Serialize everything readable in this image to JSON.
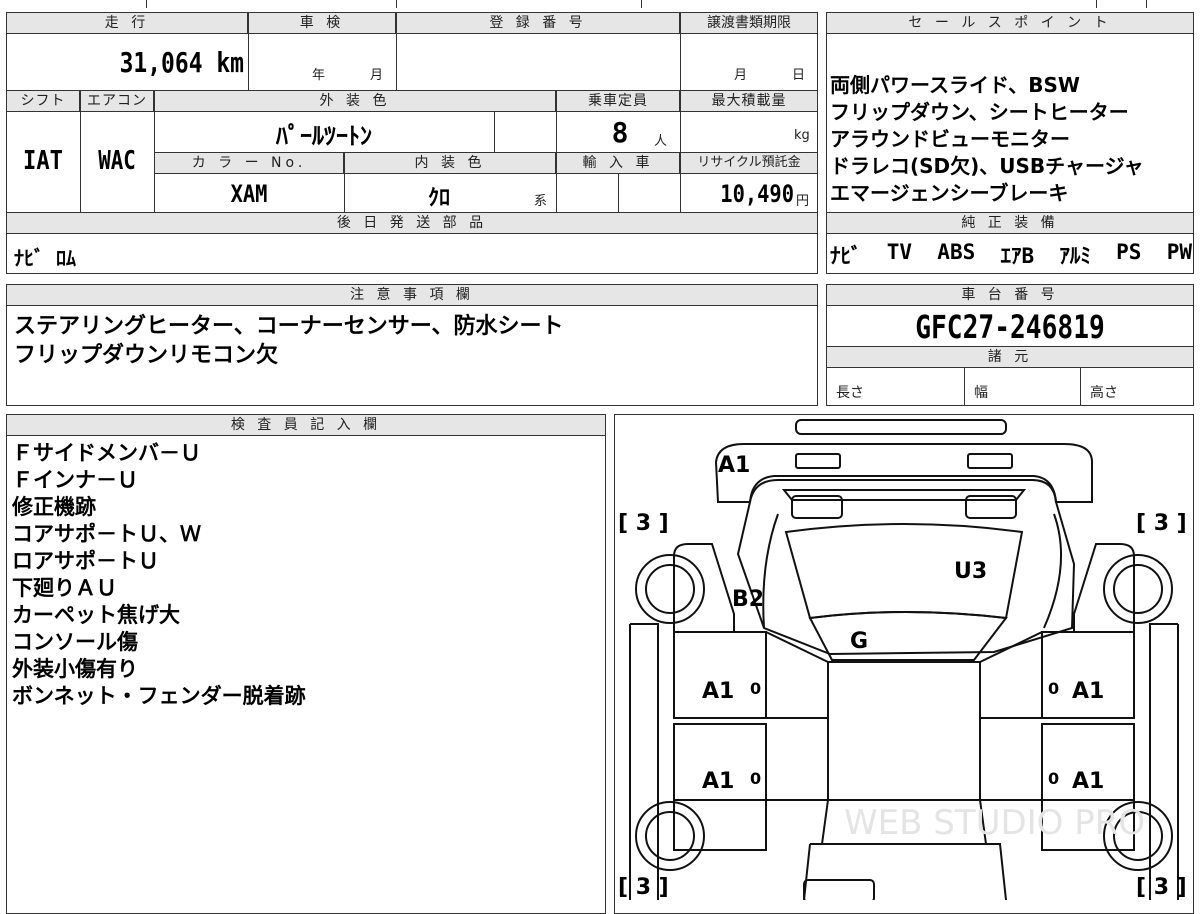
{
  "sheet": {
    "mileage": {
      "label": "走 行",
      "value": "31,064 km"
    },
    "shaken": {
      "label": "車 検",
      "year_unit": "年",
      "month_unit": "月"
    },
    "registration": {
      "label": "登 録 番 号"
    },
    "transfer": {
      "label": "譲渡書類期限",
      "month_unit": "月",
      "day_unit": "日"
    },
    "shift": {
      "label": "シフト",
      "value": "IAT"
    },
    "aircon": {
      "label": "エアコン",
      "value": "WAC"
    },
    "exterior_color": {
      "label": "外 装 色",
      "value": "ﾊﾟｰﾙﾂｰﾄﾝ"
    },
    "capacity": {
      "label": "乗車定員",
      "value": "8",
      "unit": "人"
    },
    "max_load": {
      "label": "最大積載量",
      "unit": "kg"
    },
    "color_no": {
      "label": "カ ラ ー No.",
      "value": "XAM"
    },
    "interior_color": {
      "label": "内 装 色",
      "value": "ｸﾛ",
      "unit": "系"
    },
    "import": {
      "label": "輸 入 車"
    },
    "recycle": {
      "label": "リサイクル預託金",
      "value": "10,490",
      "unit": "円"
    },
    "parts": {
      "label": "後 日 発 送 部 品",
      "value": "ﾅﾋﾞ ﾛﾑ"
    },
    "sales_points": {
      "label": "セ ー ル ス ポ イ ン ト",
      "lines": [
        "両側パワースライド、BSW",
        "フリップダウン、シートヒーター",
        "アラウンドビューモニター",
        "ドラレコ(SD欠)、USBチャージャ",
        "エマージェンシーブレーキ"
      ]
    },
    "standard_equipment": {
      "label": "純 正 装 備",
      "items": [
        "ﾅﾋﾞ",
        "TV",
        "ABS",
        "ｴｱB",
        "ｱﾙﾐ",
        "PS",
        "PW"
      ]
    },
    "notes": {
      "label": "注 意 事 項 欄",
      "lines": [
        "ステアリングヒーター、コーナーセンサー、防水シート",
        "フリップダウンリモコン欠"
      ]
    },
    "chassis": {
      "label": "車 台 番 号",
      "value": "GFC27-246819"
    },
    "specs": {
      "label": "諸 元",
      "length": "長さ",
      "width": "幅",
      "height": "高さ"
    },
    "inspector": {
      "label": "検 査 員 記 入 欄",
      "lines": [
        "Ｆサイドメンバ－Ｕ",
        "Ｆインナ－Ｕ",
        "修正機跡",
        "コアサポ－トＵ、Ｗ",
        "ロアサポ－トＵ",
        "下廻りＡＵ",
        "カーペット焦げ大",
        "コンソール傷",
        "外装小傷有り",
        "ボンネット・フェンダー脱着跡"
      ]
    }
  },
  "diagram": {
    "marks": {
      "front": "A1",
      "tire_fl": "[ 3 ]",
      "tire_fr": "[ 3 ]",
      "tire_rl": "[ 3 ]",
      "tire_rr": "[ 3 ]",
      "hood_left": "B2",
      "hood_right": "U3",
      "windshield": "G",
      "door_fl": "A1",
      "door_fr": "A1",
      "door_rl": "A1",
      "door_rr": "A1",
      "zero": "0"
    },
    "watermark": "WEB STUDIO PRO"
  }
}
